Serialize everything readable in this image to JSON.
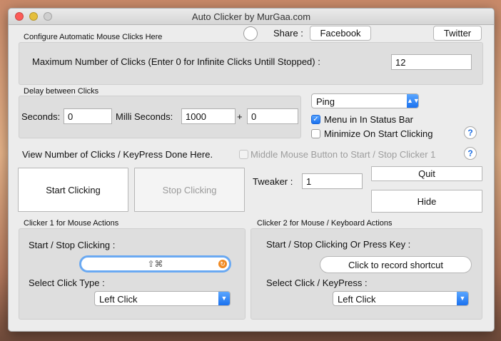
{
  "window": {
    "title": "Auto Clicker by MurGaa.com"
  },
  "header": {
    "configure_label": "Configure Automatic Mouse Clicks Here",
    "share_label": "Share :",
    "facebook_label": "Facebook",
    "twitter_label": "Twitter"
  },
  "max_clicks": {
    "label": "Maximum Number of Clicks (Enter 0 for Infinite Clicks Untill Stopped) :",
    "value": "12"
  },
  "delay": {
    "group_label": "Delay between Clicks",
    "seconds_label": "Seconds:",
    "seconds_value": "0",
    "ms_label": "Milli Seconds:",
    "ms_value": "1000",
    "plus_label": "+",
    "random_value": "0"
  },
  "options": {
    "sound_value": "Ping",
    "menu_status_bar_label": "Menu in In Status Bar",
    "menu_status_bar_checked": true,
    "minimize_label": "Minimize On Start Clicking",
    "minimize_checked": false,
    "help_glyph": "?"
  },
  "counter": {
    "label": "View Number of Clicks / KeyPress Done Here.",
    "middle_mouse_label": "Middle Mouse Button to Start / Stop Clicker 1"
  },
  "controls": {
    "start_label": "Start Clicking",
    "stop_label": "Stop Clicking",
    "tweaker_label": "Tweaker :",
    "tweaker_value": "1",
    "quit_label": "Quit",
    "hide_label": "Hide"
  },
  "clicker1": {
    "group_label": "Clicker 1 for Mouse Actions",
    "start_stop_label": "Start / Stop Clicking :",
    "shortcut_value": "⇧⌘",
    "click_type_label": "Select Click Type :",
    "click_type_value": "Left Click"
  },
  "clicker2": {
    "group_label": "Clicker 2 for Mouse / Keyboard Actions",
    "start_stop_label": "Start / Stop Clicking Or Press Key :",
    "record_label": "Click to record shortcut",
    "click_type_label": "Select Click / KeyPress :",
    "click_type_value": "Left Click"
  },
  "colors": {
    "accent": "#1a71ef",
    "close": "#fc5b57",
    "minimize": "#e5bf3c",
    "shortcut_border": "#6aa9f2",
    "clear": "#f08a23"
  }
}
